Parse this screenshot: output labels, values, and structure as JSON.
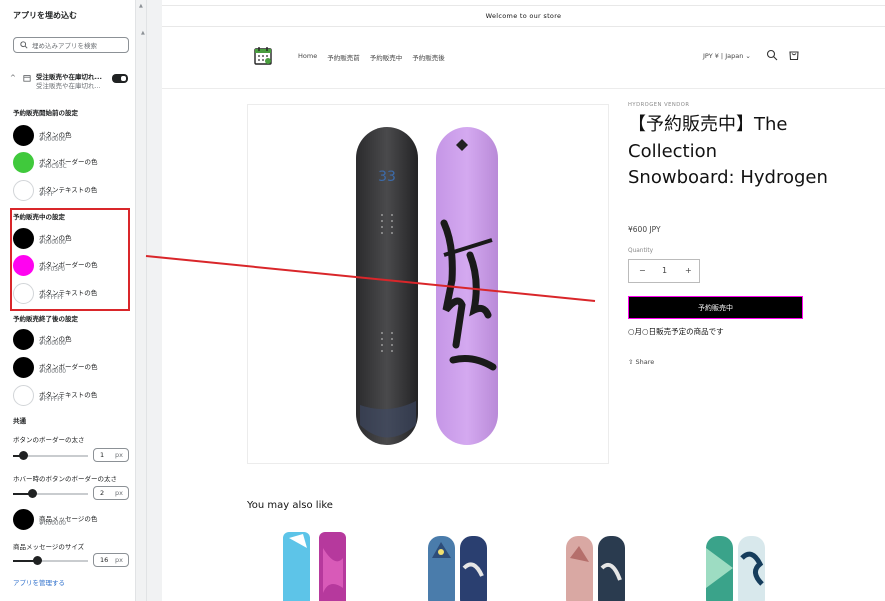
{
  "sidebar": {
    "title": "アプリを埋め込む",
    "search_placeholder": "埋め込みアプリを検索",
    "app": {
      "name": "受注販売や在庫切れ...",
      "subtitle": "受注販売や在庫切れ...",
      "enabled": true
    },
    "sections": [
      {
        "heading": "予約販売開始前の設定",
        "swatches": [
          {
            "label": "ボタンの色",
            "hex": "#000000",
            "color": "#000000"
          },
          {
            "label": "ボタンボーダーの色",
            "hex": "#40C93C",
            "color": "#40C93C"
          },
          {
            "label": "ボタンテキストの色",
            "hex": "#FFF",
            "color": "#FFFFFF"
          }
        ]
      },
      {
        "heading": "予約販売中の設定",
        "swatches": [
          {
            "label": "ボタンの色",
            "hex": "#000000",
            "color": "#000000"
          },
          {
            "label": "ボタンボーダーの色",
            "hex": "#FF03F0",
            "color": "#FF03F0"
          },
          {
            "label": "ボタンテキストの色",
            "hex": "#FFFFFF",
            "color": "#FFFFFF"
          }
        ]
      },
      {
        "heading": "予約販売終了後の設定",
        "swatches": [
          {
            "label": "ボタンの色",
            "hex": "#000000",
            "color": "#000000"
          },
          {
            "label": "ボタンボーダーの色",
            "hex": "#000000",
            "color": "#000000"
          },
          {
            "label": "ボタンテキストの色",
            "hex": "#FFFFFF",
            "color": "#FFFFFF"
          }
        ]
      }
    ],
    "common": {
      "heading": "共通",
      "border_width": {
        "label": "ボタンのボーダーの太さ",
        "value": "1",
        "unit": "px"
      },
      "hover_border_width": {
        "label": "ホバー時のボタンのボーダーの太さ",
        "value": "2",
        "unit": "px"
      },
      "message_color": {
        "label": "商品メッセージの色",
        "hex": "#000000",
        "color": "#000000"
      },
      "message_size": {
        "label": "商品メッセージのサイズ",
        "value": "16",
        "unit": "px"
      }
    },
    "manage_link": "アプリを管理する"
  },
  "store": {
    "announcement": "Welcome to our store",
    "nav": [
      "Home",
      "予約販売前",
      "予約販売中",
      "予約販売後"
    ],
    "locale": "JPY ¥ | Japan",
    "product": {
      "vendor": "HYDROGEN VENDOR",
      "title": "【予約販売中】The Collection Snowboard: Hydrogen",
      "price": "¥600 JPY",
      "quantity_label": "Quantity",
      "quantity": "1",
      "minus": "−",
      "plus": "+",
      "button_label": "予約販売中",
      "preorder_message": "○月○日販売予定の商品です",
      "share_label": "Share"
    },
    "recommendations_heading": "You may also like"
  },
  "colors": {
    "annotation": "#d9262a",
    "preorder_border": "#ff03f0",
    "link": "#2c6ecb"
  }
}
